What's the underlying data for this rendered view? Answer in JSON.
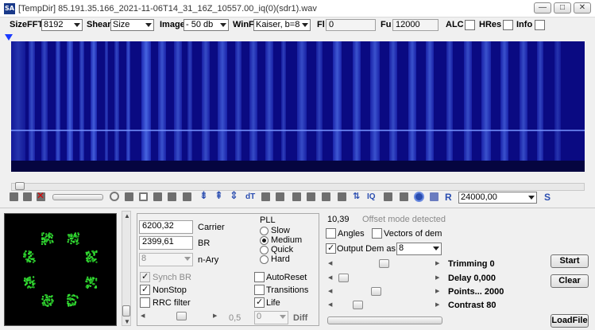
{
  "window": {
    "title": "[TempDir] 85.191.35.166_2021-11-06T14_31_16Z_10557.00_iq(0)(sdr1).wav",
    "app_icon": "SA",
    "minimize": "—",
    "maximize": "□",
    "close": "✕"
  },
  "toolbar": {
    "sizefft_label": "SizeFFT",
    "sizefft_value": "8192",
    "shear_label": "Shear",
    "shear_value": "Size",
    "image_label": "Image",
    "image_value": "- 50 db",
    "winf_label": "WinF",
    "winf_value": "Kaiser, b=8",
    "fl_label": "Fl",
    "fl_value": "0",
    "fu_label": "Fu",
    "fu_value": "12000",
    "alc_label": "ALC",
    "hres_label": "HRes",
    "info_label": "Info"
  },
  "iconbar": {
    "freq_value": "24000,00",
    "s_label": "S",
    "r_label": "R",
    "dt_label": "dT",
    "iq_label": "IQ"
  },
  "demod": {
    "carrier_value": "6200,32",
    "carrier_label": "Carrier",
    "br_value": "2399,61",
    "br_label": "BR",
    "nary_value": "8",
    "nary_label": "n-Ary",
    "synch_br": "Synch BR",
    "nonstop": "NonStop",
    "rrc_filter": "RRC filter",
    "slider_value": "0,5",
    "pll_title": "PLL",
    "pll_options": [
      "Slow",
      "Medium",
      "Quick",
      "Hard"
    ],
    "autoreset": "AutoReset",
    "transitions": "Transitions",
    "life": "Life",
    "diff_value": "0",
    "diff_label": "Diff"
  },
  "status": {
    "value": "10,39",
    "message": "Offset mode detected"
  },
  "options": {
    "angles": "Angles",
    "vectors": "Vectors of dem",
    "output_dem": "Output Dem as",
    "output_value": "8",
    "trimming": "Trimming 0",
    "delay": "Delay  0,000",
    "points": "Points... 2000",
    "contrast": "Contrast 80"
  },
  "buttons": {
    "start": "Start",
    "clear": "Clear",
    "loadfile": "LoadFile"
  },
  "colors": {
    "spectrum_bg": "#0a0a82",
    "constellation": "#33dd33",
    "accent": "#1a3a8a"
  }
}
